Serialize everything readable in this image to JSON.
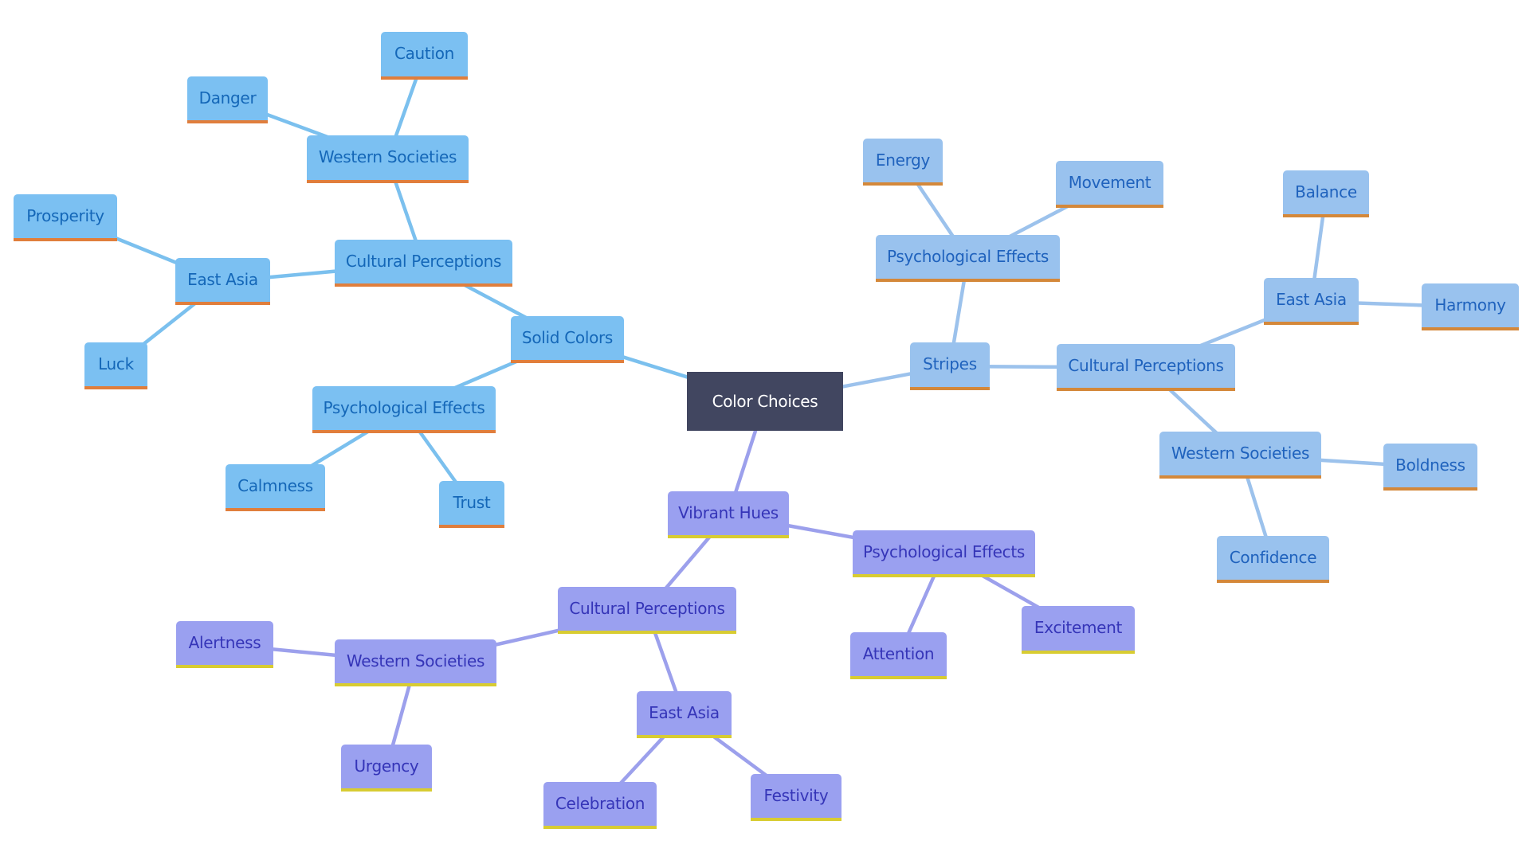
{
  "diagram": {
    "type": "mind-map",
    "root": "Color Choices",
    "colors": {
      "root_fill": "#414660",
      "root_text": "#ffffff",
      "solid_fill": "#7bc0f2",
      "solid_text": "#1467b8",
      "solid_accent": "#e07e3c",
      "stripes_fill": "#99c2ee",
      "stripes_text": "#1f62bd",
      "stripes_accent": "#d4883a",
      "vibrant_fill": "#9aa0f0",
      "vibrant_text": "#3535b8",
      "vibrant_accent": "#d8cc32"
    },
    "nodes": [
      {
        "id": "root",
        "label": "Color Choices",
        "branch": "root",
        "parent": null
      },
      {
        "id": "solid",
        "label": "Solid Colors",
        "branch": "solid",
        "parent": "root"
      },
      {
        "id": "solid-cult",
        "label": "Cultural Perceptions",
        "branch": "solid",
        "parent": "solid"
      },
      {
        "id": "solid-west",
        "label": "Western Societies",
        "branch": "solid",
        "parent": "solid-cult"
      },
      {
        "id": "solid-caution",
        "label": "Caution",
        "branch": "solid",
        "parent": "solid-west"
      },
      {
        "id": "solid-danger",
        "label": "Danger",
        "branch": "solid",
        "parent": "solid-west"
      },
      {
        "id": "solid-east",
        "label": "East Asia",
        "branch": "solid",
        "parent": "solid-cult"
      },
      {
        "id": "solid-prosperity",
        "label": "Prosperity",
        "branch": "solid",
        "parent": "solid-east"
      },
      {
        "id": "solid-luck",
        "label": "Luck",
        "branch": "solid",
        "parent": "solid-east"
      },
      {
        "id": "solid-psych",
        "label": "Psychological Effects",
        "branch": "solid",
        "parent": "solid"
      },
      {
        "id": "solid-calmness",
        "label": "Calmness",
        "branch": "solid",
        "parent": "solid-psych"
      },
      {
        "id": "solid-trust",
        "label": "Trust",
        "branch": "solid",
        "parent": "solid-psych"
      },
      {
        "id": "stripes",
        "label": "Stripes",
        "branch": "stripes",
        "parent": "root"
      },
      {
        "id": "stripes-psych",
        "label": "Psychological Effects",
        "branch": "stripes",
        "parent": "stripes"
      },
      {
        "id": "stripes-energy",
        "label": "Energy",
        "branch": "stripes",
        "parent": "stripes-psych"
      },
      {
        "id": "stripes-movement",
        "label": "Movement",
        "branch": "stripes",
        "parent": "stripes-psych"
      },
      {
        "id": "stripes-cult",
        "label": "Cultural Perceptions",
        "branch": "stripes",
        "parent": "stripes"
      },
      {
        "id": "stripes-east",
        "label": "East Asia",
        "branch": "stripes",
        "parent": "stripes-cult"
      },
      {
        "id": "stripes-balance",
        "label": "Balance",
        "branch": "stripes",
        "parent": "stripes-east"
      },
      {
        "id": "stripes-harmony",
        "label": "Harmony",
        "branch": "stripes",
        "parent": "stripes-east"
      },
      {
        "id": "stripes-west",
        "label": "Western Societies",
        "branch": "stripes",
        "parent": "stripes-cult"
      },
      {
        "id": "stripes-boldness",
        "label": "Boldness",
        "branch": "stripes",
        "parent": "stripes-west"
      },
      {
        "id": "stripes-confidence",
        "label": "Confidence",
        "branch": "stripes",
        "parent": "stripes-west"
      },
      {
        "id": "vibrant",
        "label": "Vibrant Hues",
        "branch": "vibrant",
        "parent": "root"
      },
      {
        "id": "vibrant-psych",
        "label": "Psychological Effects",
        "branch": "vibrant",
        "parent": "vibrant"
      },
      {
        "id": "vibrant-attention",
        "label": "Attention",
        "branch": "vibrant",
        "parent": "vibrant-psych"
      },
      {
        "id": "vibrant-excitement",
        "label": "Excitement",
        "branch": "vibrant",
        "parent": "vibrant-psych"
      },
      {
        "id": "vibrant-cult",
        "label": "Cultural Perceptions",
        "branch": "vibrant",
        "parent": "vibrant"
      },
      {
        "id": "vibrant-west",
        "label": "Western Societies",
        "branch": "vibrant",
        "parent": "vibrant-cult"
      },
      {
        "id": "vibrant-alertness",
        "label": "Alertness",
        "branch": "vibrant",
        "parent": "vibrant-west"
      },
      {
        "id": "vibrant-urgency",
        "label": "Urgency",
        "branch": "vibrant",
        "parent": "vibrant-west"
      },
      {
        "id": "vibrant-east",
        "label": "East Asia",
        "branch": "vibrant",
        "parent": "vibrant-cult"
      },
      {
        "id": "vibrant-celebration",
        "label": "Celebration",
        "branch": "vibrant",
        "parent": "vibrant-east"
      },
      {
        "id": "vibrant-festivity",
        "label": "Festivity",
        "branch": "vibrant",
        "parent": "vibrant-east"
      }
    ]
  }
}
